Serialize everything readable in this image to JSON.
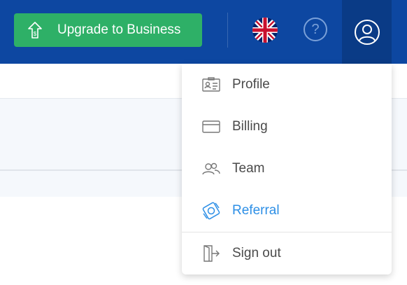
{
  "header": {
    "upgrade_label": "Upgrade to Business",
    "help_glyph": "?",
    "language_icon": "uk-flag-icon",
    "account_icon": "user-circle-icon"
  },
  "colors": {
    "header_bg": "#0d47a1",
    "upgrade_bg": "#2eb067",
    "active_item": "#2d8fe6"
  },
  "menu": {
    "items": [
      {
        "label": "Profile",
        "icon": "id-card-icon"
      },
      {
        "label": "Billing",
        "icon": "credit-card-icon"
      },
      {
        "label": "Team",
        "icon": "users-icon"
      },
      {
        "label": "Referral",
        "icon": "referral-money-icon",
        "active": true
      },
      {
        "label": "Sign out",
        "icon": "sign-out-icon"
      }
    ]
  }
}
